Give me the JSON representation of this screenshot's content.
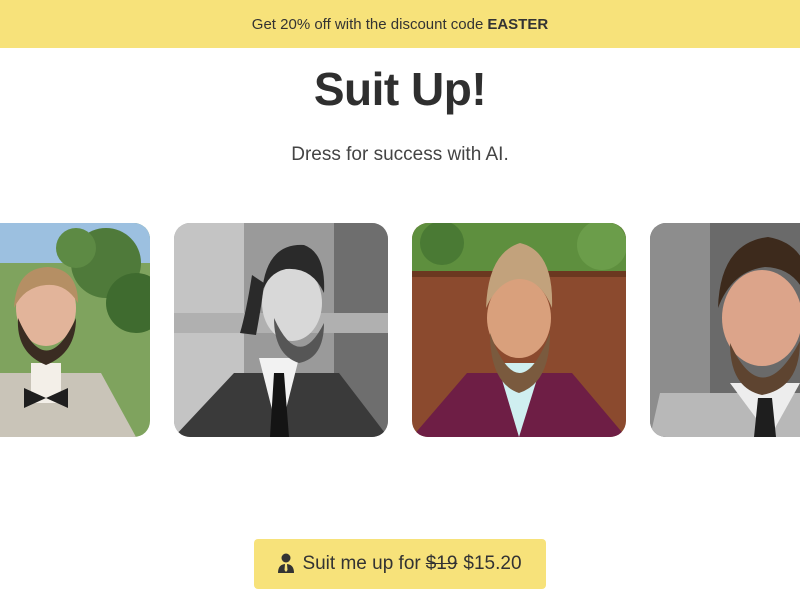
{
  "banner": {
    "text": "Get 20% off with the discount code",
    "code": "EASTER"
  },
  "hero": {
    "title": "Suit Up!",
    "subtitle": "Dress for success with AI."
  },
  "gallery": {
    "images": [
      {
        "alt": "Bearded man in light suit and bow tie outdoors"
      },
      {
        "alt": "Black and white portrait of bearded man in suit"
      },
      {
        "alt": "Bearded man in maroon suit jacket"
      },
      {
        "alt": "Bearded man in grey suit"
      }
    ]
  },
  "cta": {
    "icon": "person-icon",
    "label": "Suit me up for",
    "old_price": "$19",
    "new_price": "$15.20"
  },
  "colors": {
    "accent": "#f7e27a",
    "text": "#333333"
  }
}
